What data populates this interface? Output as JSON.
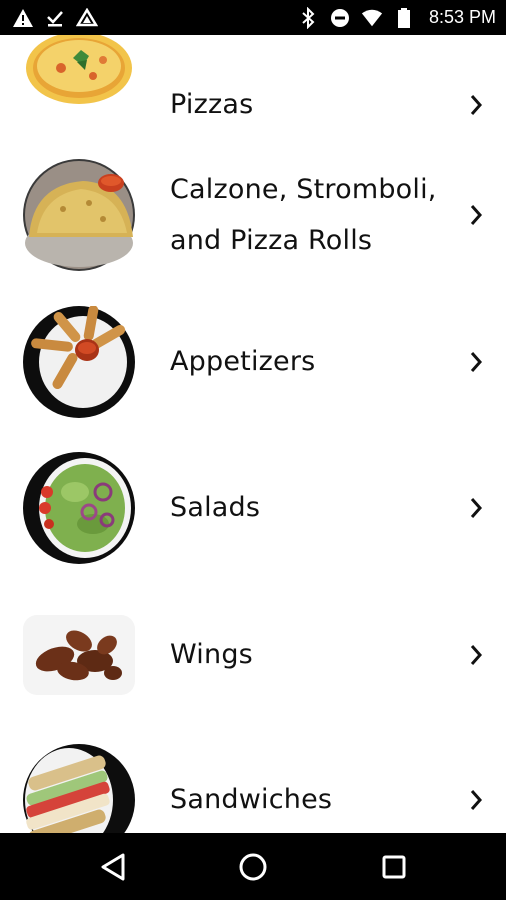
{
  "status_bar": {
    "time": "8:53 PM",
    "left_icons": [
      "warning-icon",
      "download-done-icon",
      "drive-icon"
    ],
    "right_icons": [
      "bluetooth-icon",
      "do-not-disturb-icon",
      "wifi-icon",
      "battery-icon"
    ]
  },
  "menu": {
    "categories": [
      {
        "label": "Pizzas",
        "image": "pizza-image"
      },
      {
        "label_line1": "Calzone, Stromboli,",
        "label_line2": "and Pizza Rolls",
        "image": "calzone-image"
      },
      {
        "label": "Appetizers",
        "image": "appetizers-image"
      },
      {
        "label": "Salads",
        "image": "salad-image"
      },
      {
        "label": "Wings",
        "image": "wings-image"
      },
      {
        "label": "Sandwiches",
        "image": "sandwich-image"
      }
    ]
  },
  "nav_bar": {
    "buttons": [
      "back-icon",
      "home-icon",
      "recents-icon"
    ]
  },
  "colors": {
    "text": "#111111",
    "bar": "#000000",
    "background": "#ffffff"
  }
}
